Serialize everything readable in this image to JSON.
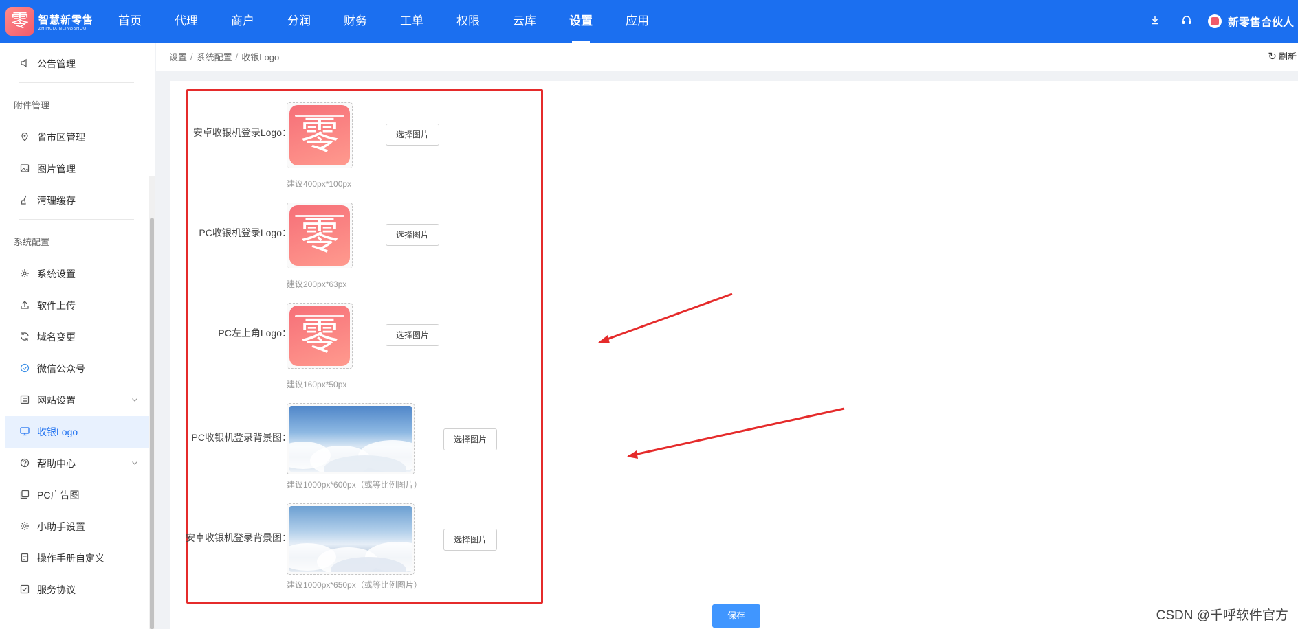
{
  "brand": {
    "name_cn": "智慧新零售",
    "name_en": "ZHIHUIXINLINGSHOU",
    "glyph": "零"
  },
  "nav": {
    "items": [
      {
        "label": "首页"
      },
      {
        "label": "代理"
      },
      {
        "label": "商户"
      },
      {
        "label": "分润"
      },
      {
        "label": "财务"
      },
      {
        "label": "工单"
      },
      {
        "label": "权限"
      },
      {
        "label": "云库"
      },
      {
        "label": "设置"
      },
      {
        "label": "应用"
      }
    ],
    "active": "设置"
  },
  "header": {
    "user_name": "新零售合伙人",
    "download_icon": "download-icon",
    "headset_icon": "headset-icon"
  },
  "sidebar": {
    "top_item": {
      "label": "公告管理",
      "icon": "speaker-icon"
    },
    "group1": "附件管理",
    "group1_items": [
      {
        "label": "省市区管理",
        "icon": "location-icon"
      },
      {
        "label": "图片管理",
        "icon": "image-icon"
      },
      {
        "label": "清理缓存",
        "icon": "broom-icon"
      }
    ],
    "group2": "系统配置",
    "group2_items": [
      {
        "label": "系统设置",
        "icon": "gear-icon"
      },
      {
        "label": "软件上传",
        "icon": "upload-icon"
      },
      {
        "label": "域名变更",
        "icon": "sync-icon"
      },
      {
        "label": "微信公众号",
        "icon": "wechat-icon"
      },
      {
        "label": "网站设置",
        "icon": "sliders-icon"
      },
      {
        "label": "收银Logo",
        "icon": "monitor-icon"
      },
      {
        "label": "帮助中心",
        "icon": "help-icon"
      },
      {
        "label": "PC广告图",
        "icon": "picture-icon"
      },
      {
        "label": "小助手设置",
        "icon": "gear-icon"
      },
      {
        "label": "操作手册自定义",
        "icon": "document-icon"
      },
      {
        "label": "服务协议",
        "icon": "checkbox-icon"
      }
    ],
    "active": "收银Logo"
  },
  "breadcrumb": {
    "items": [
      "设置",
      "系统配置",
      "收银Logo"
    ],
    "separator": "/",
    "refresh_label": "刷新"
  },
  "form": {
    "rows": [
      {
        "label": "安卓收银机登录Logo：",
        "button": "选择图片",
        "hint": "建议400px*100px",
        "kind": "logo"
      },
      {
        "label": "PC收银机登录Logo：",
        "button": "选择图片",
        "hint": "建议200px*63px",
        "kind": "logo"
      },
      {
        "label": "PC左上角Logo：",
        "button": "选择图片",
        "hint": "建议160px*50px",
        "kind": "logo"
      },
      {
        "label": "PC收银机登录背景图：",
        "button": "选择图片",
        "hint": "建议1000px*600px（或等比例图片）",
        "kind": "sky"
      },
      {
        "label": "安卓收银机登录背景图：",
        "button": "选择图片",
        "hint": "建议1000px*650px（或等比例图片）",
        "kind": "sky"
      }
    ],
    "save_label": "保存"
  },
  "watermark": "CSDN @千呼软件官方",
  "colors": {
    "primary": "#1b6ff0",
    "annotation_red": "#e52b2b",
    "save_button": "#4096ff"
  }
}
